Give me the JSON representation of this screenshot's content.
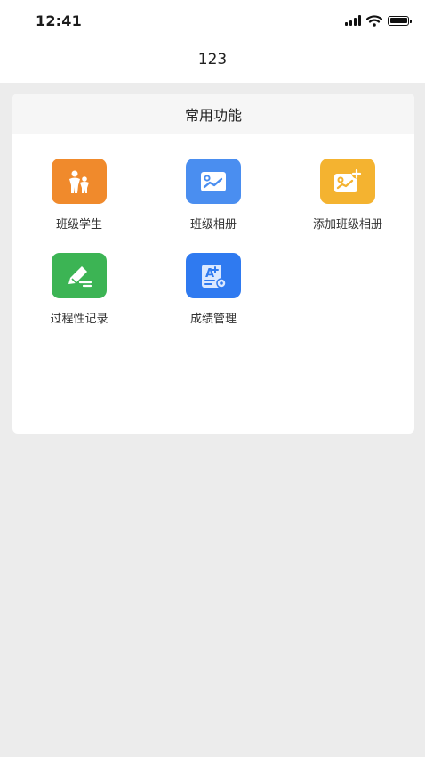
{
  "status_bar": {
    "time": "12:41"
  },
  "header": {
    "title": "123"
  },
  "section": {
    "title": "常用功能"
  },
  "features": [
    {
      "label": "班级学生",
      "icon": "class-students-icon",
      "color": "#f08a2c"
    },
    {
      "label": "班级相册",
      "icon": "class-album-icon",
      "color": "#4a8ef0"
    },
    {
      "label": "添加班级相册",
      "icon": "add-class-album-icon",
      "color": "#f4b330"
    },
    {
      "label": "过程性记录",
      "icon": "process-record-icon",
      "color": "#3cb454"
    },
    {
      "label": "成绩管理",
      "icon": "grade-management-icon",
      "color": "#2f7af0"
    }
  ]
}
